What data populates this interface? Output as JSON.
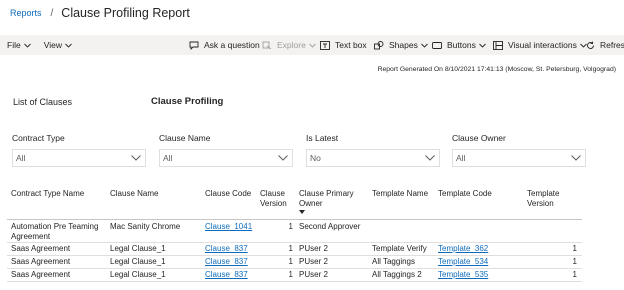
{
  "breadcrumb": {
    "parent": "Reports",
    "separator": "/",
    "title": "Clause Profiling Report"
  },
  "toolbar": {
    "file": "File",
    "view": "View",
    "ask_question": "Ask a question",
    "explore": "Explore",
    "text_box": "Text box",
    "shapes": "Shapes",
    "buttons": "Buttons",
    "visual_interactions": "Visual interactions",
    "refresh": "Refresh"
  },
  "report_generated": "Report Generated On 8/10/2021 17:41:13 (Moscow, St. Petersburg, Volgograd)",
  "headers": {
    "left": "List of Clauses",
    "mid": "Clause Profiling"
  },
  "filters": [
    {
      "label": "Contract Type",
      "value": "All"
    },
    {
      "label": "Clause Name",
      "value": "All"
    },
    {
      "label": "Is Latest",
      "value": "No"
    },
    {
      "label": "Clause Owner",
      "value": "All"
    }
  ],
  "table": {
    "columns": [
      "Contract Type Name",
      "Clause Name",
      "Clause Code",
      "Clause Version",
      "Clause Primary Owner",
      "Template Name",
      "Template Code",
      "Template Version"
    ],
    "rows": [
      [
        "Automation Pre Teaming Agreement",
        "Mac Sanity Chrome",
        "Clause_1041",
        "1",
        "Second Approver",
        "",
        "",
        ""
      ],
      [
        "Saas Agreement",
        "Legal Clause_1",
        "Clause_837",
        "1",
        "PUser 2",
        "Template Verify",
        "Template_362",
        "1"
      ],
      [
        "Saas Agreement",
        "Legal Clause_1",
        "Clause_837",
        "1",
        "PUser 2",
        "All Taggings",
        "Template_534",
        "1"
      ],
      [
        "Saas Agreement",
        "Legal Clause_1",
        "Clause_837",
        "1",
        "PUser 2",
        "All Taggings 2",
        "Template_535",
        "1"
      ]
    ]
  }
}
